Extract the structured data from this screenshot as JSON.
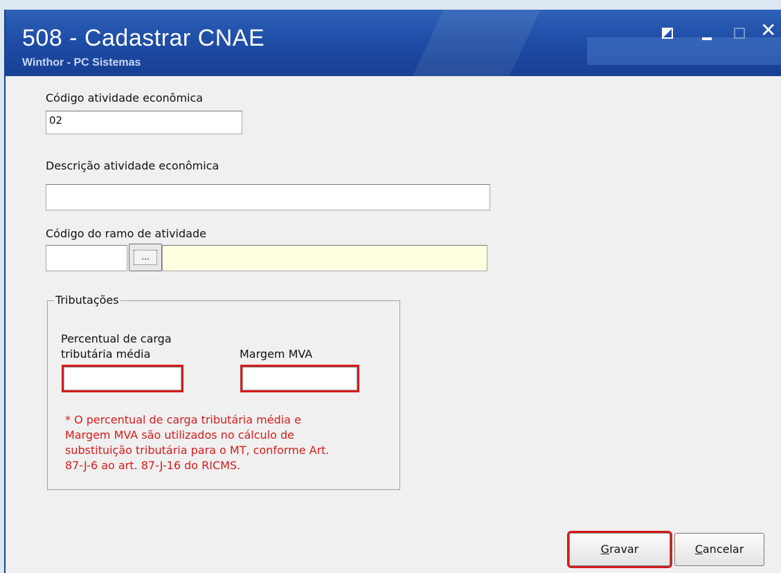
{
  "window": {
    "title": "508 - Cadastrar CNAE",
    "subtitle": "Winthor - PC Sistemas"
  },
  "form": {
    "codigo_label": "Código atividade econômica",
    "codigo_value": "02",
    "descricao_label": "Descrição  atividade econômica",
    "descricao_value": "",
    "ramo_label": "Código do ramo de atividade",
    "ramo_code_value": "",
    "ramo_desc_value": "",
    "lookup_button_label": "..."
  },
  "tributacoes": {
    "title": "Tributações",
    "percentual_label_line1": "Percentual de carga",
    "percentual_label_line2": "tributária média",
    "percentual_value": "",
    "margem_label": "Margem MVA",
    "margem_value": "",
    "note_line1": "* O percentual de carga tributária média e",
    "note_line2": "Margem MVA são utilizados no cálculo de",
    "note_line3": "substituição tributária para o MT, conforme Art.",
    "note_line4": "87-J-6 ao art. 87-J-16 do RICMS."
  },
  "buttons": {
    "gravar_first": "G",
    "gravar_rest": "ravar",
    "cancelar_first": "C",
    "cancelar_rest": "ancelar"
  },
  "colors": {
    "highlight": "#d41c1c",
    "titlebar": "#1f4ea7",
    "readonly_field": "#ffffe1"
  }
}
